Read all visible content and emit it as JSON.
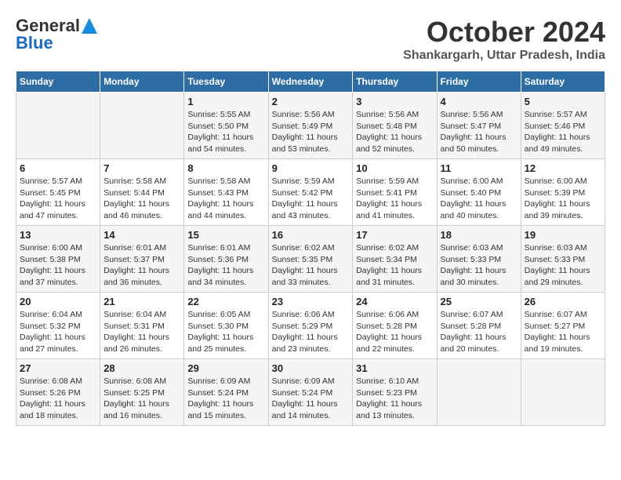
{
  "logo": {
    "line1": "General",
    "line2": "Blue"
  },
  "title": "October 2024",
  "subtitle": "Shankargarh, Uttar Pradesh, India",
  "days_of_week": [
    "Sunday",
    "Monday",
    "Tuesday",
    "Wednesday",
    "Thursday",
    "Friday",
    "Saturday"
  ],
  "weeks": [
    [
      {
        "day": "",
        "content": ""
      },
      {
        "day": "",
        "content": ""
      },
      {
        "day": "1",
        "content": "Sunrise: 5:55 AM\nSunset: 5:50 PM\nDaylight: 11 hours and 54 minutes."
      },
      {
        "day": "2",
        "content": "Sunrise: 5:56 AM\nSunset: 5:49 PM\nDaylight: 11 hours and 53 minutes."
      },
      {
        "day": "3",
        "content": "Sunrise: 5:56 AM\nSunset: 5:48 PM\nDaylight: 11 hours and 52 minutes."
      },
      {
        "day": "4",
        "content": "Sunrise: 5:56 AM\nSunset: 5:47 PM\nDaylight: 11 hours and 50 minutes."
      },
      {
        "day": "5",
        "content": "Sunrise: 5:57 AM\nSunset: 5:46 PM\nDaylight: 11 hours and 49 minutes."
      }
    ],
    [
      {
        "day": "6",
        "content": "Sunrise: 5:57 AM\nSunset: 5:45 PM\nDaylight: 11 hours and 47 minutes."
      },
      {
        "day": "7",
        "content": "Sunrise: 5:58 AM\nSunset: 5:44 PM\nDaylight: 11 hours and 46 minutes."
      },
      {
        "day": "8",
        "content": "Sunrise: 5:58 AM\nSunset: 5:43 PM\nDaylight: 11 hours and 44 minutes."
      },
      {
        "day": "9",
        "content": "Sunrise: 5:59 AM\nSunset: 5:42 PM\nDaylight: 11 hours and 43 minutes."
      },
      {
        "day": "10",
        "content": "Sunrise: 5:59 AM\nSunset: 5:41 PM\nDaylight: 11 hours and 41 minutes."
      },
      {
        "day": "11",
        "content": "Sunrise: 6:00 AM\nSunset: 5:40 PM\nDaylight: 11 hours and 40 minutes."
      },
      {
        "day": "12",
        "content": "Sunrise: 6:00 AM\nSunset: 5:39 PM\nDaylight: 11 hours and 39 minutes."
      }
    ],
    [
      {
        "day": "13",
        "content": "Sunrise: 6:00 AM\nSunset: 5:38 PM\nDaylight: 11 hours and 37 minutes."
      },
      {
        "day": "14",
        "content": "Sunrise: 6:01 AM\nSunset: 5:37 PM\nDaylight: 11 hours and 36 minutes."
      },
      {
        "day": "15",
        "content": "Sunrise: 6:01 AM\nSunset: 5:36 PM\nDaylight: 11 hours and 34 minutes."
      },
      {
        "day": "16",
        "content": "Sunrise: 6:02 AM\nSunset: 5:35 PM\nDaylight: 11 hours and 33 minutes."
      },
      {
        "day": "17",
        "content": "Sunrise: 6:02 AM\nSunset: 5:34 PM\nDaylight: 11 hours and 31 minutes."
      },
      {
        "day": "18",
        "content": "Sunrise: 6:03 AM\nSunset: 5:33 PM\nDaylight: 11 hours and 30 minutes."
      },
      {
        "day": "19",
        "content": "Sunrise: 6:03 AM\nSunset: 5:33 PM\nDaylight: 11 hours and 29 minutes."
      }
    ],
    [
      {
        "day": "20",
        "content": "Sunrise: 6:04 AM\nSunset: 5:32 PM\nDaylight: 11 hours and 27 minutes."
      },
      {
        "day": "21",
        "content": "Sunrise: 6:04 AM\nSunset: 5:31 PM\nDaylight: 11 hours and 26 minutes."
      },
      {
        "day": "22",
        "content": "Sunrise: 6:05 AM\nSunset: 5:30 PM\nDaylight: 11 hours and 25 minutes."
      },
      {
        "day": "23",
        "content": "Sunrise: 6:06 AM\nSunset: 5:29 PM\nDaylight: 11 hours and 23 minutes."
      },
      {
        "day": "24",
        "content": "Sunrise: 6:06 AM\nSunset: 5:28 PM\nDaylight: 11 hours and 22 minutes."
      },
      {
        "day": "25",
        "content": "Sunrise: 6:07 AM\nSunset: 5:28 PM\nDaylight: 11 hours and 20 minutes."
      },
      {
        "day": "26",
        "content": "Sunrise: 6:07 AM\nSunset: 5:27 PM\nDaylight: 11 hours and 19 minutes."
      }
    ],
    [
      {
        "day": "27",
        "content": "Sunrise: 6:08 AM\nSunset: 5:26 PM\nDaylight: 11 hours and 18 minutes."
      },
      {
        "day": "28",
        "content": "Sunrise: 6:08 AM\nSunset: 5:25 PM\nDaylight: 11 hours and 16 minutes."
      },
      {
        "day": "29",
        "content": "Sunrise: 6:09 AM\nSunset: 5:24 PM\nDaylight: 11 hours and 15 minutes."
      },
      {
        "day": "30",
        "content": "Sunrise: 6:09 AM\nSunset: 5:24 PM\nDaylight: 11 hours and 14 minutes."
      },
      {
        "day": "31",
        "content": "Sunrise: 6:10 AM\nSunset: 5:23 PM\nDaylight: 11 hours and 13 minutes."
      },
      {
        "day": "",
        "content": ""
      },
      {
        "day": "",
        "content": ""
      }
    ]
  ]
}
